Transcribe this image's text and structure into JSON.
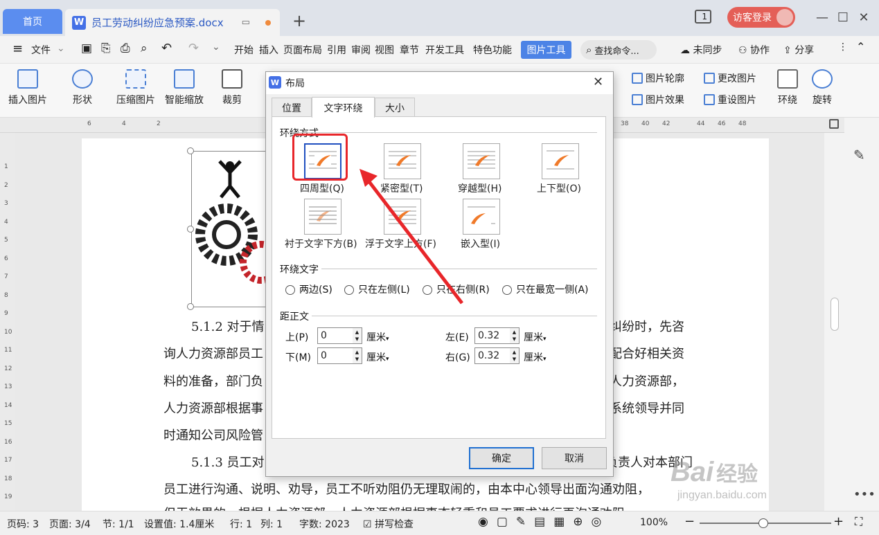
{
  "titlebar": {
    "home_tab": "首页",
    "doc_tab": "员工劳动纠纷应急预案.docx",
    "new_tab": "+",
    "login_button": "访客登录",
    "window_badge": "1"
  },
  "menu": {
    "file": "文件",
    "items": [
      "开始",
      "插入",
      "页面布局",
      "引用",
      "审阅",
      "视图",
      "章节",
      "开发工具",
      "特色功能"
    ],
    "active_tab": "图片工具",
    "search_placeholder": "查找命令...",
    "sync": "未同步",
    "collab": "协作",
    "share": "分享"
  },
  "ribbon": {
    "insert_picture": "插入图片",
    "shape": "形状",
    "compress": "压缩图片",
    "smart_scale": "智能缩放",
    "crop": "裁剪",
    "outline": "图片轮廓",
    "change_picture": "更改图片",
    "effects": "图片效果",
    "reset_picture": "重设图片",
    "wrap": "环绕",
    "rotate": "旋转"
  },
  "ruler": {
    "h_ticks_left": [
      "6",
      "4",
      "2"
    ],
    "h_ticks_right": [
      "38",
      "40",
      "42",
      "44",
      "46",
      "48"
    ],
    "v_ticks": [
      "1",
      "2",
      "3",
      "4",
      "5",
      "6",
      "7",
      "8",
      "9",
      "10",
      "11",
      "12",
      "13",
      "14",
      "15",
      "16",
      "17",
      "18",
      "19"
    ]
  },
  "document": {
    "lines": [
      "5.1.2 对于情",
      "纠纷时，先咨",
      "询人力资源部员工",
      "配合好相关资",
      "料的准备，部门负",
      "人力资源部，",
      "人力资源部根据事",
      "系统领导并同",
      "时通知公司风险管",
      "5.1.3 员工对",
      "负责人对本部门",
      "员工进行沟通、说明、劝导，员工不听劝阻仍无理取闹的，由本中心领导出面沟通劝阻，",
      "但无效果的，根据人力资源部，人力资源部根据事态轻重和员工要求进行再沟通劝阻"
    ]
  },
  "dialog": {
    "title": "布局",
    "tabs": [
      "位置",
      "文字环绕",
      "大小"
    ],
    "wrap_section": "环绕方式",
    "wrap_options": [
      "四周型(Q)",
      "紧密型(T)",
      "穿越型(H)",
      "上下型(O)",
      "衬于文字下方(B)",
      "浮于文字上方(F)",
      "嵌入型(I)"
    ],
    "wrap_text_section": "环绕文字",
    "wrap_text_options": [
      "两边(S)",
      "只在左侧(L)",
      "只在右侧(R)",
      "只在最宽一侧(A)"
    ],
    "distance_section": "距正文",
    "fields": {
      "top": {
        "label": "上(P)",
        "value": "0",
        "unit": "厘米"
      },
      "bottom": {
        "label": "下(M)",
        "value": "0",
        "unit": "厘米"
      },
      "left": {
        "label": "左(E)",
        "value": "0.32",
        "unit": "厘米"
      },
      "right": {
        "label": "右(G)",
        "value": "0.32",
        "unit": "厘米"
      }
    },
    "ok": "确定",
    "cancel": "取消"
  },
  "statusbar": {
    "page_code": "页码: 3",
    "page": "页面: 3/4",
    "section": "节: 1/1",
    "setting": "设置值: 1.4厘米",
    "row": "行: 1",
    "col": "列: 1",
    "words": "字数: 2023",
    "spell": "拼写检查",
    "zoom": "100%"
  },
  "watermark": {
    "brand": "Bai",
    "brand_cn": "经验",
    "url": "jingyan.baidu.com"
  },
  "colors": {
    "accent": "#4c83e6",
    "highlight_box": "#e8262a",
    "login": "#e45f57"
  }
}
